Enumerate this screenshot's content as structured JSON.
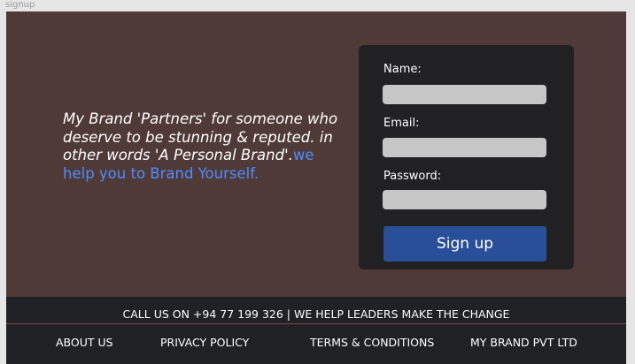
{
  "frame": {
    "label": "signup"
  },
  "hero": {
    "text_main": "My Brand 'Partners' for someone who deserve to be stunning & reputed. in other words 'A Personal Brand'.",
    "text_accent": "we help you to Brand Yourself."
  },
  "form": {
    "name_label": "Name:",
    "name_value": "",
    "email_label": "Email:",
    "email_value": "",
    "password_label": "Password:",
    "password_value": "",
    "submit_label": "Sign up"
  },
  "footer": {
    "call_text": "CALL US ON +94 77 199 326 | WE HELP LEADERS MAKE THE CHANGE",
    "links": [
      {
        "label": "ABOUT US"
      },
      {
        "label": "PRIVACY POLICY"
      },
      {
        "label": "TERMS & CONDITIONS"
      },
      {
        "label": "MY BRAND PVT LTD"
      }
    ]
  },
  "colors": {
    "page_background": "#4f3a37",
    "card_background": "#212124",
    "footer_background": "#202124",
    "accent_text": "#4f8cff",
    "button": "#284f97",
    "input": "#c6c6c6"
  }
}
